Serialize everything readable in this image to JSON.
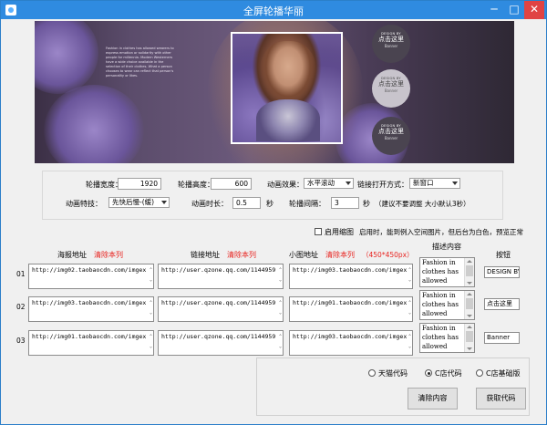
{
  "window": {
    "title": "全屏轮播华丽",
    "min": "─",
    "max": "□",
    "close": "✕"
  },
  "banner": {
    "blurb": "Fashion in clothes has allowed wearers to express emotion or solidarity with other people for millennia. Modern Westerners have a wide choice available in the selection of their clothes. What a person chooses to wear can reflect that person's personality or likes.",
    "circles": [
      {
        "small": "DESIGN BY",
        "big": "点击这里",
        "en": "Banner"
      },
      {
        "small": "DESIGN BY",
        "big": "点击这里",
        "en": "Banner"
      },
      {
        "small": "DESIGN BY",
        "big": "点击这里",
        "en": "Banner"
      }
    ]
  },
  "settings": {
    "width_label": "轮播宽度：",
    "width_value": "1920",
    "height_label": "轮播高度：",
    "height_value": "600",
    "effect_label": "动画效果：",
    "effect_value": "水平滚动",
    "link_label": "链接打开方式：",
    "link_value": "新窗口",
    "special_label": "动画特技：",
    "special_value": "先快后慢-(缓)",
    "duration_label": "动画时长：",
    "duration_value": "0.5",
    "duration_unit": "秒",
    "interval_label": "轮播间隔：",
    "interval_value": "3",
    "interval_unit": "秒",
    "interval_hint": "（建议不要调整 大小默认3秒）"
  },
  "thumb_option": {
    "label": "启用缩图",
    "hint": "启用时，能到例入空间图片，但后台为白色，预览正常"
  },
  "columns": {
    "poster": "海报地址",
    "poster_clear": "清除本列",
    "link": "链接地址",
    "link_clear": "清除本列",
    "thumb": "小图地址",
    "thumb_clear": "清除本列",
    "thumb_size": "（450*450px）",
    "desc": "描述内容",
    "button": "按钮"
  },
  "rows": [
    {
      "num": "01",
      "poster": "http://img02.taobaocdn.com/imgex",
      "link": "http://user.qzone.qq.com/1144959",
      "thumb": "http://img03.taobaocdn.com/imgex",
      "desc": "Fashion in clothes has allowed",
      "button": "DESIGN BY"
    },
    {
      "num": "02",
      "poster": "http://img03.taobaocdn.com/imgex",
      "link": "http://user.qzone.qq.com/1144959",
      "thumb": "http://img01.taobaocdn.com/imgex",
      "desc": "Fashion in clothes has allowed",
      "button": "点击这里"
    },
    {
      "num": "03",
      "poster": "http://img01.taobaocdn.com/imgex",
      "link": "http://user.qzone.qq.com/1144959",
      "thumb": "http://img03.taobaocdn.com/imgex",
      "desc": "Fashion in clothes has allowed",
      "button": "Banner"
    }
  ],
  "code_options": {
    "tmall": "天猫代码",
    "cshop": "C店代码",
    "cshop_basic": "C店基础版",
    "selected": "cshop"
  },
  "actions": {
    "clear": "清除内容",
    "get": "获取代码"
  }
}
